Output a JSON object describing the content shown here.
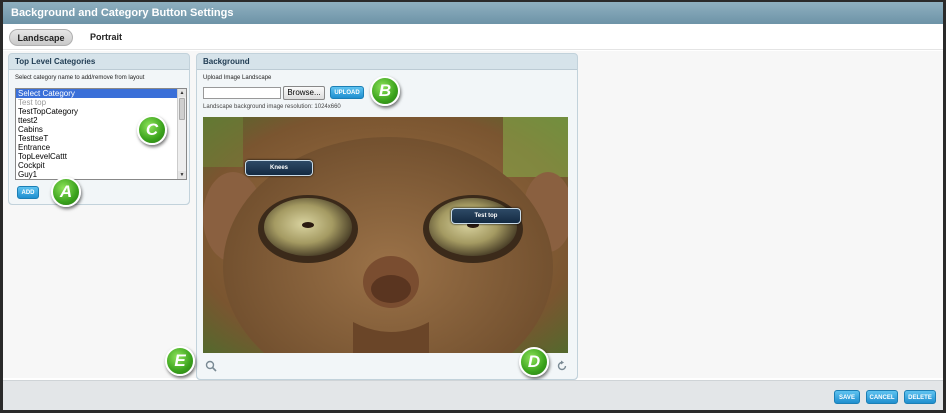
{
  "window": {
    "title": "Background and Category Button Settings"
  },
  "tabs": [
    {
      "label": "Landscape",
      "active": true
    },
    {
      "label": "Portrait",
      "active": false
    }
  ],
  "categories_panel": {
    "title": "Top Level Categories",
    "instruction": "Select category name to add/remove from layout",
    "list_items": [
      {
        "label": "Select Category",
        "state": "selected"
      },
      {
        "label": "Test top",
        "state": "muted"
      },
      {
        "label": "TestTopCategory",
        "state": "normal"
      },
      {
        "label": "ttest2",
        "state": "normal"
      },
      {
        "label": "Cabins",
        "state": "normal"
      },
      {
        "label": "TesttseT",
        "state": "normal"
      },
      {
        "label": "Entrance",
        "state": "normal"
      },
      {
        "label": "TopLevelCattt",
        "state": "normal"
      },
      {
        "label": "Cockpit",
        "state": "normal"
      },
      {
        "label": "Guy1",
        "state": "normal"
      }
    ],
    "add_label": "ADD"
  },
  "background_panel": {
    "title": "Background",
    "upload_label": "Upload Image Landscape",
    "file_value": "",
    "browse_label": "Browse...",
    "upload_button": "UPLOAD",
    "resolution_note": "Landscape background image resolution: 1024x660",
    "category_buttons": [
      {
        "label": "Knees"
      },
      {
        "label": "Test top"
      }
    ],
    "tools": {
      "zoom_icon": "magnifier-icon",
      "reset_icon": "rotate-icon"
    }
  },
  "callouts": [
    "A",
    "B",
    "C",
    "D",
    "E"
  ],
  "footer": {
    "save_label": "SAVE",
    "cancel_label": "CANCEL",
    "delete_label": "DELETE"
  },
  "colors": {
    "accent": "#1f8fcf",
    "titlebar": "#6d93a7",
    "callout": "#3aa21c",
    "selected": "#3a6fd8"
  }
}
